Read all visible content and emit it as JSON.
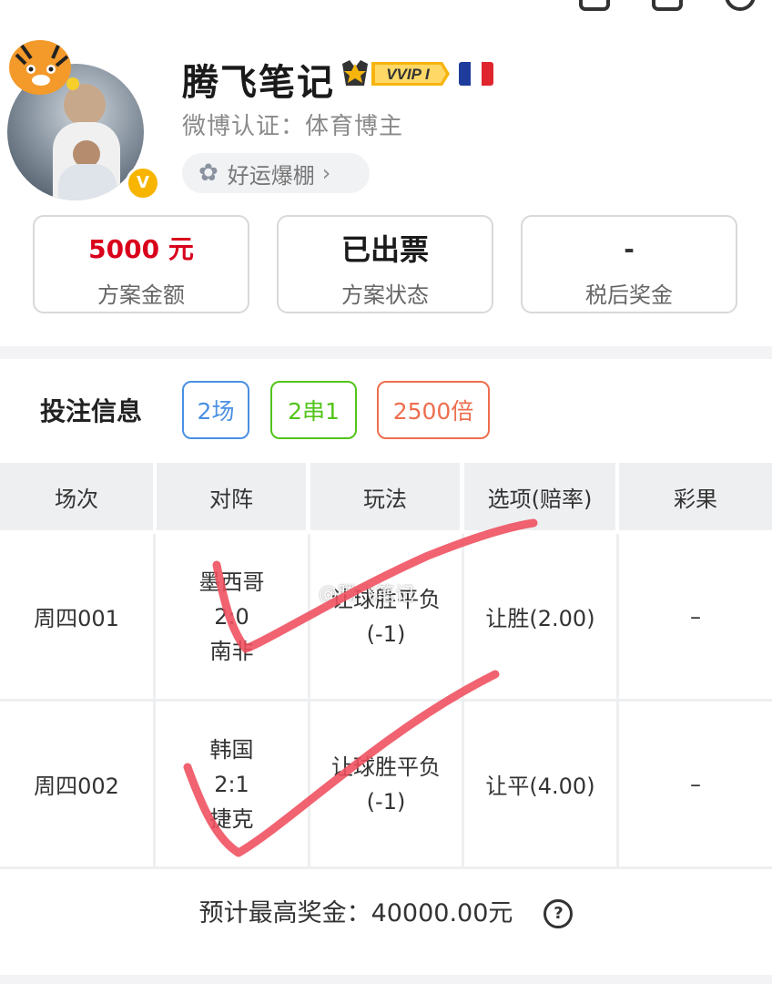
{
  "colors": {
    "amount_red": "#d9001b",
    "tag_blue": "#4a90e2",
    "tag_green": "#52c41a",
    "tag_orange": "#ee6e4f",
    "check_red": "#ef4d5c",
    "vip_gold": "#f6b40e"
  },
  "profile": {
    "username": "腾飞笔记",
    "vip_badge": "VVIP I",
    "verification": "微博认证：体育博主",
    "luck_label": "好运爆棚",
    "luck_chevron": "›",
    "verified_mark": "V",
    "icons": [
      "add-user-icon",
      "scan-icon",
      "settings-icon",
      "clover-icon",
      "tiger-sticker-icon",
      "france-flag-icon"
    ]
  },
  "stats": [
    {
      "value": "5000 元",
      "label": "方案金额"
    },
    {
      "value": "已出票",
      "label": "方案状态"
    },
    {
      "value": "-",
      "label": "税后奖金"
    }
  ],
  "bet": {
    "title": "投注信息",
    "tags": [
      "2场",
      "2串1",
      "2500倍"
    ]
  },
  "table": {
    "headers": [
      "场次",
      "对阵",
      "玩法",
      "选项(赔率)",
      "彩果"
    ],
    "rows": [
      {
        "match_no": "周四001",
        "home": "墨西哥",
        "score": "2:0",
        "away": "南非",
        "play": "让球胜平负",
        "handicap": "(-1)",
        "pick": "让胜(2.00)",
        "result": "–"
      },
      {
        "match_no": "周四002",
        "home": "韩国",
        "score": "2:1",
        "away": "捷克",
        "play": "让球胜平负",
        "handicap": "(-1)",
        "pick": "让平(4.00)",
        "result": "–"
      }
    ]
  },
  "watermark": "@腾飞笔记",
  "summary": {
    "text": "预计最高奖金：40000.00元",
    "help_icon": "?"
  }
}
